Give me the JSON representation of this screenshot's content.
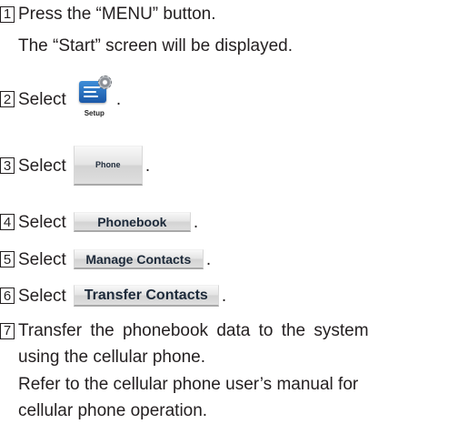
{
  "steps": [
    {
      "number": "1",
      "text": "Press the “MENU” button.",
      "detail": "The “Start” screen will be displayed."
    },
    {
      "number": "2",
      "text": "Select",
      "icon_label": "Setup",
      "icon": "setup-icon"
    },
    {
      "number": "3",
      "text": "Select",
      "button_label": "Phone"
    },
    {
      "number": "4",
      "text": "Select",
      "button_label": "Phonebook"
    },
    {
      "number": "5",
      "text": "Select",
      "button_label": "Manage Contacts"
    },
    {
      "number": "6",
      "text": "Select",
      "button_label": "Transfer Contacts"
    },
    {
      "number": "7",
      "text": "Transfer the phonebook data to the system",
      "lines": [
        "using the cellular phone.",
        "Refer to the cellular phone user’s manual for",
        "cellular phone operation."
      ]
    }
  ],
  "period": "."
}
